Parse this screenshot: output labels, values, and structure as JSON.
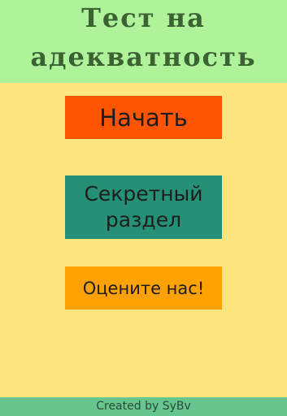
{
  "header": {
    "title_line1": "Тест на",
    "title_line2": "адекватность"
  },
  "buttons": {
    "start": "Начать",
    "secret_line1": "Секретный",
    "secret_line2": "раздел",
    "rate": "Оцените нас!"
  },
  "footer": {
    "credit": "Created by SyBv"
  },
  "colors": {
    "header_bg": "#AEF29A",
    "page_bg": "#FFE57F",
    "start_bg": "#FF5500",
    "secret_bg": "#259075",
    "rate_bg": "#FFA200",
    "footer_bg": "#66C68E"
  }
}
